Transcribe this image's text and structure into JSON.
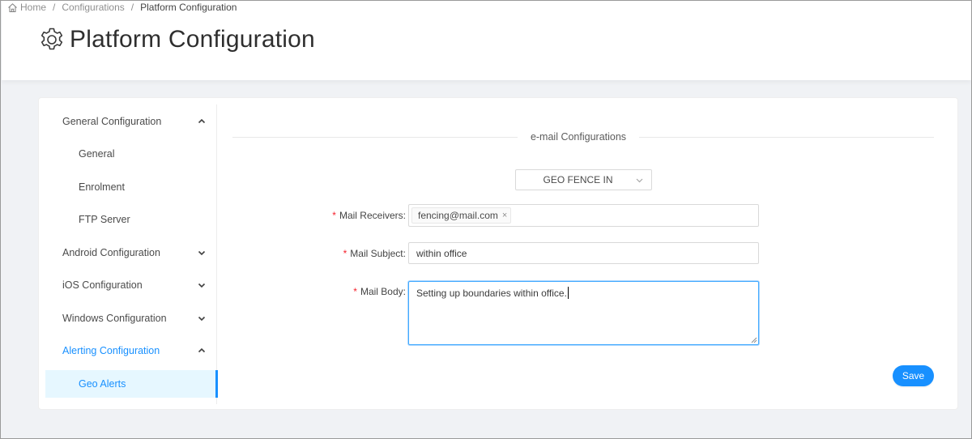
{
  "breadcrumb": {
    "home": "Home",
    "configurations": "Configurations",
    "current": "Platform Configuration",
    "separator": "/"
  },
  "header": {
    "title": "Platform Configuration",
    "icon": "gear-icon"
  },
  "sidebar": {
    "items": [
      {
        "label": "General Configuration",
        "level": "top",
        "state": "expanded"
      },
      {
        "label": "General",
        "level": "sub"
      },
      {
        "label": "Enrolment",
        "level": "sub"
      },
      {
        "label": "FTP Server",
        "level": "sub"
      },
      {
        "label": "Android Configuration",
        "level": "top",
        "state": "collapsed"
      },
      {
        "label": "iOS Configuration",
        "level": "top",
        "state": "collapsed"
      },
      {
        "label": "Windows Configuration",
        "level": "top",
        "state": "collapsed"
      },
      {
        "label": "Alerting Configuration",
        "level": "top",
        "state": "expanded-active"
      },
      {
        "label": "Geo Alerts",
        "level": "sub",
        "state": "selected"
      }
    ]
  },
  "main": {
    "section_title": "e-mail Configurations",
    "alert_type": {
      "selected": "GEO FENCE IN"
    },
    "form": {
      "required_mark": "*",
      "receivers": {
        "label": "Mail Receivers",
        "tags": [
          "fencing@mail.com"
        ],
        "tag_close": "×"
      },
      "subject": {
        "label": "Mail Subject",
        "value": "within office"
      },
      "body": {
        "label": "Mail Body",
        "value": "Setting up boundaries within office."
      },
      "label_suffix": ":"
    },
    "save_label": "Save"
  },
  "colors": {
    "accent": "#1890ff",
    "required": "#f5222d",
    "selected_bg": "#e6f7ff"
  }
}
